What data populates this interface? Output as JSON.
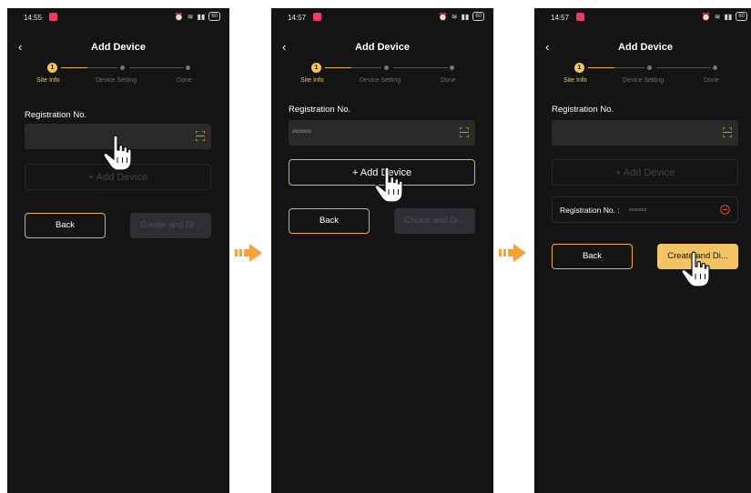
{
  "panels": [
    {
      "status": {
        "time": "14:55",
        "battery": "60"
      },
      "title": "Add Device",
      "steps": [
        "Site Info",
        "Device Setting",
        "Done"
      ],
      "registration_label": "Registration No.",
      "registration_value": "",
      "add_device_label": "+ Add Device",
      "back_label": "Back",
      "create_label": "Create and Di..."
    },
    {
      "status": {
        "time": "14:57",
        "battery": "60"
      },
      "title": "Add Device",
      "steps": [
        "Site Info",
        "Device Setting",
        "Done"
      ],
      "registration_label": "Registration No.",
      "registration_value": "xxxxxxx",
      "add_device_label": "+ Add Device",
      "back_label": "Back",
      "create_label": "Create and Di..."
    },
    {
      "status": {
        "time": "14:57",
        "battery": "60"
      },
      "title": "Add Device",
      "steps": [
        "Site Info",
        "Device Setting",
        "Done"
      ],
      "registration_label": "Registration No.",
      "registration_value": "",
      "add_device_label": "+ Add Device",
      "added_device_label": "Registration No. :",
      "added_device_value": "xxxxxxx",
      "back_label": "Back",
      "create_label": "Create and Di..."
    }
  ],
  "colors": {
    "accent": "#f2c463",
    "background": "#141414",
    "arrow": "#f2a33a"
  }
}
